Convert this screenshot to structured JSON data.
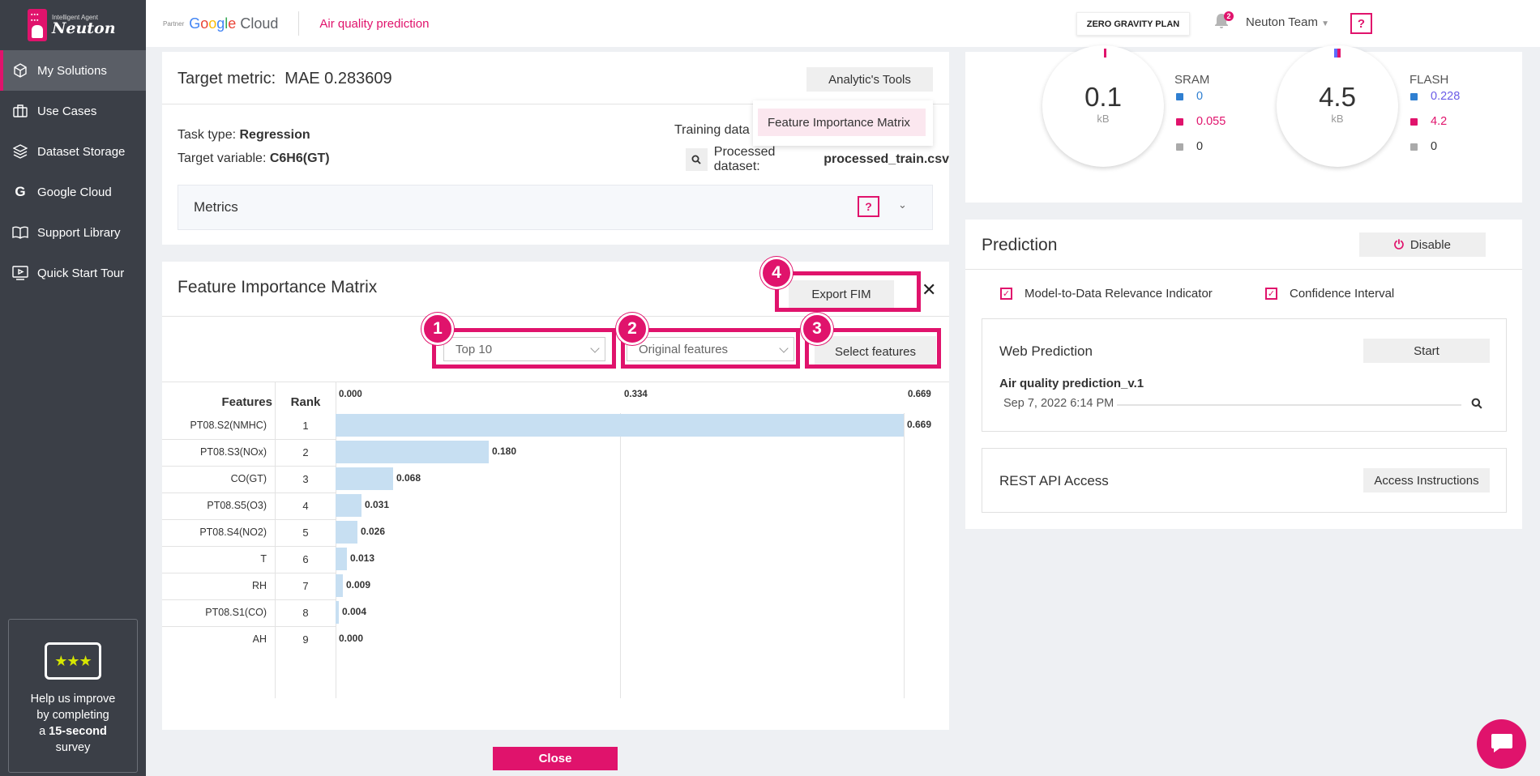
{
  "brand": {
    "subtitle": "Intelligent Agent",
    "name": "Neuton"
  },
  "sidebar": {
    "items": [
      {
        "label": "My Solutions",
        "icon": "cube-icon"
      },
      {
        "label": "Use Cases",
        "icon": "briefcase-icon"
      },
      {
        "label": "Dataset Storage",
        "icon": "layers-icon"
      },
      {
        "label": "Google Cloud",
        "icon": "google-g-icon"
      },
      {
        "label": "Support Library",
        "icon": "book-icon"
      },
      {
        "label": "Quick Start Tour",
        "icon": "video-icon"
      }
    ],
    "survey": {
      "line1": "Help us improve",
      "line2": "by completing",
      "line3_prefix": "a ",
      "line3_bold": "15-second",
      "line4": "survey"
    }
  },
  "topbar": {
    "partner": "Partner",
    "gcloud": [
      "G",
      "o",
      "o",
      "g",
      "l",
      "e"
    ],
    "gcloud_suffix": "Cloud",
    "app_title": "Air quality prediction",
    "plan": "ZERO GRAVITY PLAN",
    "notifications": "2",
    "team": "Neuton Team",
    "help": "?"
  },
  "target": {
    "title_label": "Target metric:",
    "title_value": "MAE 0.283609",
    "analytics_btn": "Analytic's Tools",
    "dropdown_item": "Feature Importance Matrix",
    "task_label": "Task type:",
    "task_value": "Regression",
    "variable_label": "Target variable:",
    "variable_value": "C6H6(GT)",
    "training_label": "Training data",
    "processed_label": "Processed dataset:",
    "processed_value": "processed_train.csv",
    "metrics": "Metrics",
    "metrics_help": "?"
  },
  "fim": {
    "title": "Feature Importance Matrix",
    "export_btn": "Export FIM",
    "close": "✕",
    "top_select": "Top 10",
    "features_select": "Original features",
    "select_btn": "Select features",
    "badges": [
      "1",
      "2",
      "3",
      "4"
    ],
    "col_features": "Features",
    "col_rank": "Rank",
    "axis": [
      "0.000",
      "0.334",
      "0.669"
    ],
    "rows": [
      {
        "feature": "PT08.S2(NMHC)",
        "rank": "1",
        "value": 0.669,
        "label": "0.669"
      },
      {
        "feature": "PT08.S3(NOx)",
        "rank": "2",
        "value": 0.18,
        "label": "0.180"
      },
      {
        "feature": "CO(GT)",
        "rank": "3",
        "value": 0.068,
        "label": "0.068"
      },
      {
        "feature": "PT08.S5(O3)",
        "rank": "4",
        "value": 0.031,
        "label": "0.031"
      },
      {
        "feature": "PT08.S4(NO2)",
        "rank": "5",
        "value": 0.026,
        "label": "0.026"
      },
      {
        "feature": "T",
        "rank": "6",
        "value": 0.013,
        "label": "0.013"
      },
      {
        "feature": "RH",
        "rank": "7",
        "value": 0.009,
        "label": "0.009"
      },
      {
        "feature": "PT08.S1(CO)",
        "rank": "8",
        "value": 0.004,
        "label": "0.004"
      },
      {
        "feature": "AH",
        "rank": "9",
        "value": 0.0,
        "label": "0.000"
      }
    ],
    "close_btn": "Close"
  },
  "memory": {
    "sram": {
      "value": "0.1",
      "unit": "kB",
      "title": "SRAM",
      "items": [
        {
          "value": "0",
          "color": "#2f7fd1"
        },
        {
          "value": "0.055",
          "color": "#e0136c"
        },
        {
          "value": "0",
          "color": "#333333"
        }
      ]
    },
    "flash": {
      "value": "4.5",
      "unit": "kB",
      "title": "FLASH",
      "items": [
        {
          "value": "0.228",
          "color": "#6b5ce7"
        },
        {
          "value": "4.2",
          "color": "#e0136c"
        },
        {
          "value": "0",
          "color": "#333333"
        }
      ]
    }
  },
  "prediction": {
    "title": "Prediction",
    "disable_btn": "Disable",
    "check1": "Model-to-Data Relevance Indicator",
    "check2": "Confidence Interval",
    "web_title": "Web Prediction",
    "start_btn": "Start",
    "model_name": "Air quality prediction_v.1",
    "model_date": "Sep 7, 2022 6:14 PM",
    "rest_title": "REST API Access",
    "access_btn": "Access Instructions"
  },
  "colors": {
    "accent": "#e0136c",
    "sidebar": "#3b3f47",
    "bar": "#c7dff2"
  }
}
